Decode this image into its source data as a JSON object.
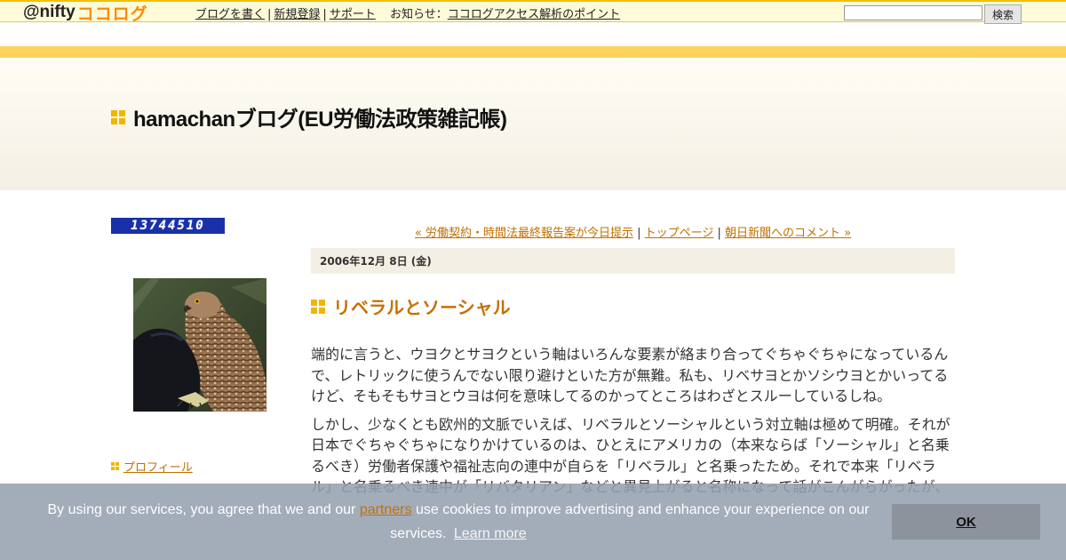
{
  "topbar": {
    "logo_prefix": "@nifty",
    "logo_brand": "ココログ",
    "links": [
      "ブログを書く",
      "新規登録",
      "サポート"
    ],
    "news_label": "お知らせ",
    "news_colon": "：",
    "news_link": "ココログアクセス解析のポイント",
    "search_placeholder": "",
    "search_button": "検索"
  },
  "header": {
    "blog_title": "hamachanブログ(EU労働法政策雑記帳)"
  },
  "sidebar": {
    "counter": "13744510",
    "avatar_alt": "hawk-photo",
    "profile_link": "プロフィール"
  },
  "nav": {
    "prev": "« 労働契約・時間法最終報告案が今日提示",
    "sep1": " | ",
    "top": "トップページ",
    "sep2": " | ",
    "next": "朝日新聞へのコメント »"
  },
  "post": {
    "date": "2006年12月 8日 (金)",
    "title": "リベラルとソーシャル",
    "paragraphs": [
      "端的に言うと、ウヨクとサヨクという軸はいろんな要素が絡まり合ってぐちゃぐちゃになっているんで、レトリックに使うんでない限り避けといた方が無難。私も、リベサヨとかソシウヨとかいってるけど、そもそもサヨとウヨは何を意味してるのかってところはわざとスルーしているしね。",
      "しかし、少なくとも欧州的文脈でいえば、リベラルとソーシャルという対立軸は極めて明確。それが日本でぐちゃぐちゃになりかけているのは、ひとえにアメリカの（本来ならば「ソーシャル」と名乗るべき）労働者保護や福祉志向の連中が自らを「リベラル」と名乗ったため。それで本来「リベラル」と名乗るべき連中が「リバタリアン」などと異見上がると名称になって話がこんがらがったが、"
    ]
  },
  "cookie": {
    "text_before": "By using our services, you agree that we and our ",
    "partners": "partners",
    "text_after": " use cookies to improve advertising and enhance your experience on our services.",
    "learn_more": "Learn more",
    "ok": "OK"
  },
  "colors": {
    "accent": "#c67000",
    "square_icon": "#f2b600",
    "yellow_band": "#fcd35b",
    "cookie_bg": "#969faf"
  }
}
